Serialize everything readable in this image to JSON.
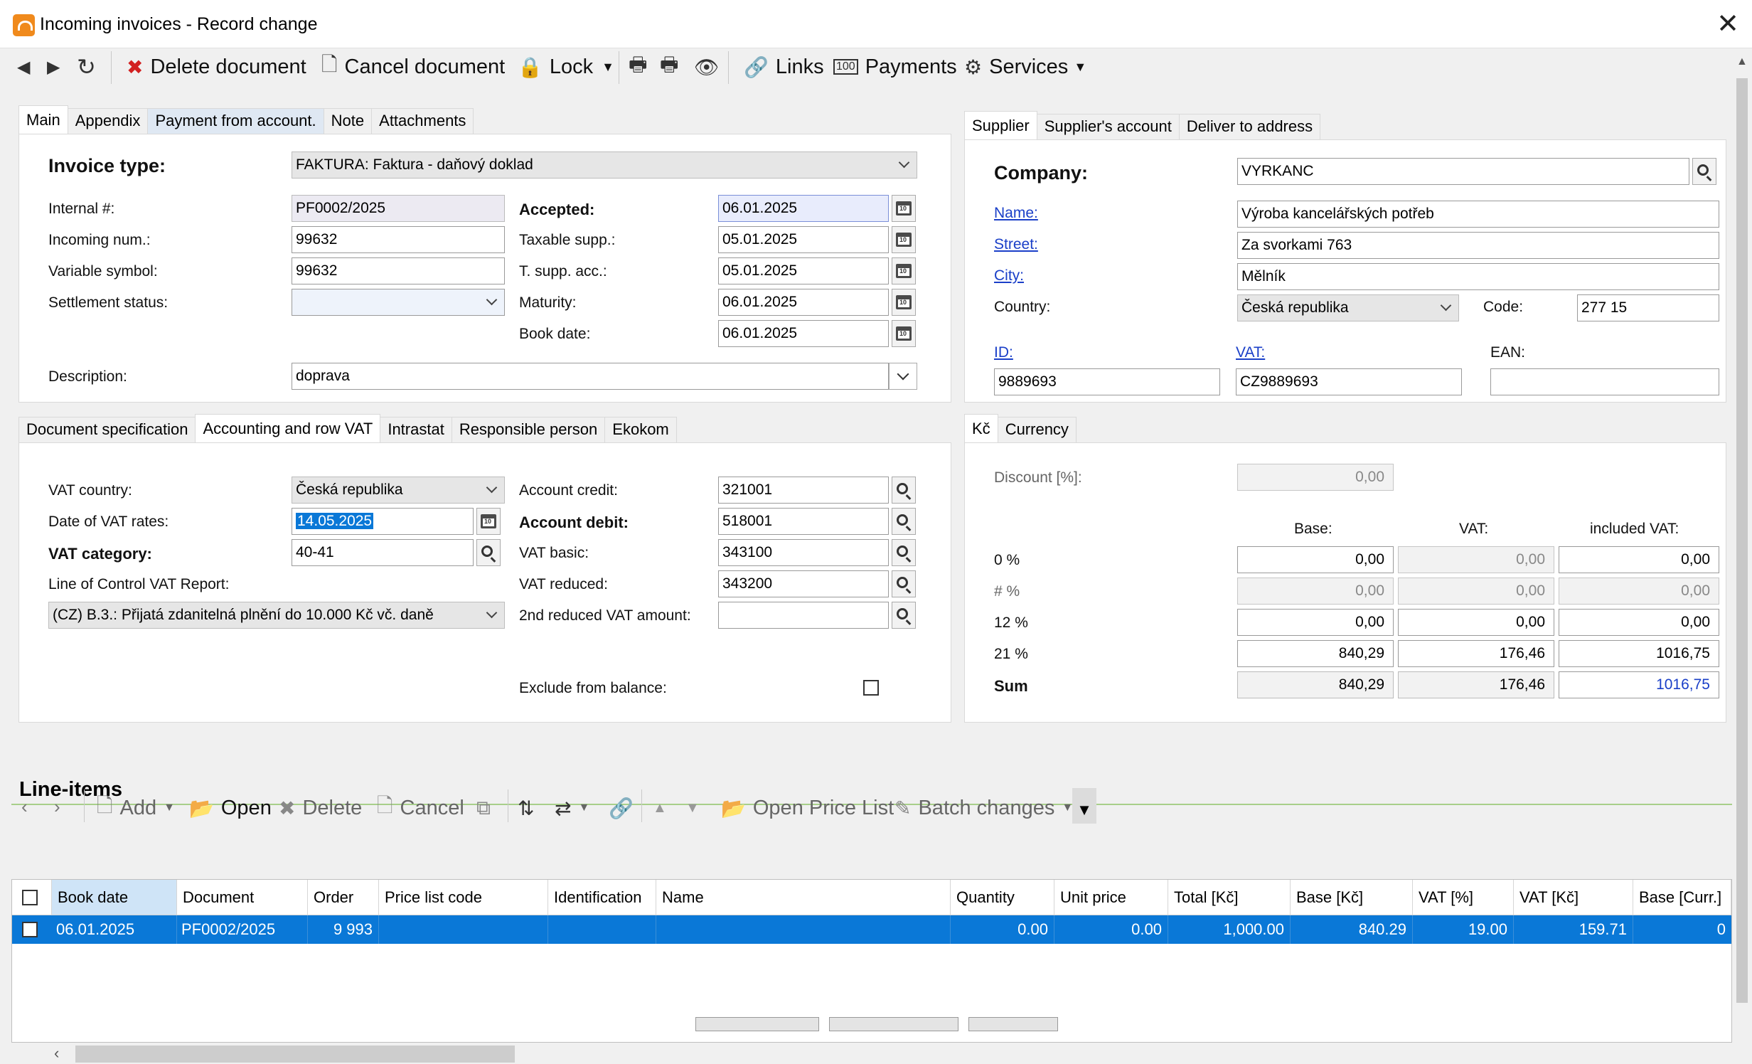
{
  "window": {
    "title": "Incoming invoices - Record change"
  },
  "toolbar": {
    "delete_document": "Delete document",
    "cancel_document": "Cancel document",
    "lock": "Lock",
    "links": "Links",
    "payments": "Payments",
    "services": "Services"
  },
  "main_tabs": [
    "Main",
    "Appendix",
    "Payment from account.",
    "Note",
    "Attachments"
  ],
  "main": {
    "invoice_type_label": "Invoice type:",
    "invoice_type_value": "FAKTURA: Faktura - daňový doklad",
    "internal_label": "Internal #:",
    "internal_value": "PF0002/2025",
    "incoming_num_label": "Incoming num.:",
    "incoming_num_value": "99632",
    "variable_symbol_label": "Variable symbol:",
    "variable_symbol_value": "99632",
    "settlement_status_label": "Settlement status:",
    "settlement_status_value": "",
    "accepted_label": "Accepted:",
    "accepted_value": "06.01.2025",
    "taxable_supp_label": "Taxable supp.:",
    "taxable_supp_value": "05.01.2025",
    "t_supp_acc_label": "T. supp. acc.:",
    "t_supp_acc_value": "05.01.2025",
    "maturity_label": "Maturity:",
    "maturity_value": "06.01.2025",
    "book_date_label": "Book date:",
    "book_date_value": "06.01.2025",
    "description_label": "Description:",
    "description_value": "doprava"
  },
  "supplier_tabs": [
    "Supplier",
    "Supplier's account",
    "Deliver to address"
  ],
  "supplier": {
    "company_label": "Company:",
    "company_value": "VYRKANC",
    "name_label": "Name:",
    "name_value": "Výroba kancelářských potřeb",
    "street_label": "Street:",
    "street_value": "Za svorkami 763",
    "city_label": "City:",
    "city_value": "Mělník",
    "country_label": "Country:",
    "country_value": "Česká republika",
    "code_label": "Code:",
    "code_value": "277 15",
    "id_label": "ID:",
    "id_value": "9889693",
    "vat_label": "VAT:",
    "vat_value": "CZ9889693",
    "ean_label": "EAN:",
    "ean_value": ""
  },
  "doc_tabs": [
    "Document specification",
    "Accounting and row VAT",
    "Intrastat",
    "Responsible person",
    "Ekokom"
  ],
  "accounting": {
    "vat_country_label": "VAT country:",
    "vat_country_value": "Česká republika",
    "date_vat_rates_label": "Date of VAT rates:",
    "date_vat_rates_value": "14.05.2025",
    "vat_category_label": "VAT category:",
    "vat_category_value": "40-41",
    "control_report_label": "Line of Control VAT Report:",
    "control_report_value": "(CZ) B.3.: Přijatá zdanitelná plnění do 10.000 Kč vč. daně",
    "account_credit_label": "Account credit:",
    "account_credit_value": "321001",
    "account_debit_label": "Account debit:",
    "account_debit_value": "518001",
    "vat_basic_label": "VAT basic:",
    "vat_basic_value": "343100",
    "vat_reduced_label": "VAT reduced:",
    "vat_reduced_value": "343200",
    "vat_2nd_reduced_label": "2nd reduced VAT amount:",
    "vat_2nd_reduced_value": "",
    "exclude_balance_label": "Exclude from balance:",
    "exclude_balance_checked": false
  },
  "currency_tabs": [
    "Kč",
    "Currency"
  ],
  "vat_summary": {
    "discount_label": "Discount [%]:",
    "discount_value": "0,00",
    "col_base": "Base:",
    "col_vat": "VAT:",
    "col_included_vat": "included VAT:",
    "rows": [
      {
        "label": "0 %",
        "base": "0,00",
        "vat": "0,00",
        "included": "0,00"
      },
      {
        "label": "# %",
        "base": "0,00",
        "vat": "0,00",
        "included": "0,00"
      },
      {
        "label": "12 %",
        "base": "0,00",
        "vat": "0,00",
        "included": "0,00"
      },
      {
        "label": "21 %",
        "base": "840,29",
        "vat": "176,46",
        "included": "1016,75"
      },
      {
        "label": "Sum",
        "base": "840,29",
        "vat": "176,46",
        "included": "1016,75"
      }
    ]
  },
  "line_items": {
    "title": "Line-items",
    "toolbar": {
      "add": "Add",
      "open": "Open",
      "delete": "Delete",
      "cancel": "Cancel",
      "open_price_list": "Open Price List",
      "batch_changes": "Batch changes"
    },
    "columns": [
      "Book date",
      "Document",
      "Order",
      "Price list code",
      "Identification",
      "Name",
      "Quantity",
      "Unit price",
      "Total [Kč]",
      "Base [Kč]",
      "VAT [%]",
      "VAT [Kč]",
      "Base [Curr.]"
    ],
    "rows": [
      {
        "book_date": "06.01.2025",
        "document": "PF0002/2025",
        "order": "9 993",
        "price_list_code": "",
        "identification": "",
        "name": "",
        "quantity": "0.00",
        "unit_price": "0.00",
        "total": "1,000.00",
        "base": "840.29",
        "vat_pct": "19.00",
        "vat_kc": "159.71",
        "base_curr": "0"
      }
    ]
  },
  "colors": {
    "selection": "#0a78d7",
    "link": "#1a3fc8",
    "app_icon": "#f08a1c",
    "delete_red": "#d22020"
  }
}
